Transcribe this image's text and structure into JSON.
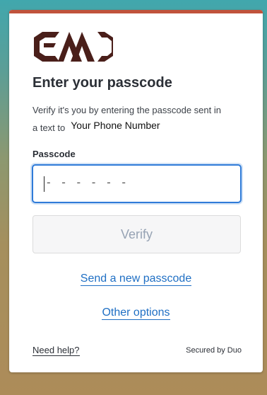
{
  "header": {
    "title": "Enter your passcode",
    "description_line1": "Verify it's you by entering the passcode sent in",
    "description_line2": "a text to",
    "phone": "Your Phone Number"
  },
  "form": {
    "label": "Passcode",
    "placeholder": "- - - - - -",
    "value": "",
    "verify_label": "Verify"
  },
  "links": {
    "send_new": "Send a new passcode",
    "other_options": "Other options"
  },
  "footer": {
    "help": "Need help?",
    "secured": "Secured by Duo"
  },
  "colors": {
    "accent_bar": "#c0533c",
    "logo": "#4a1f1a",
    "link": "#1f6fc4",
    "focus": "#2f7bd8"
  },
  "icons": {
    "logo": "brand-logo"
  }
}
